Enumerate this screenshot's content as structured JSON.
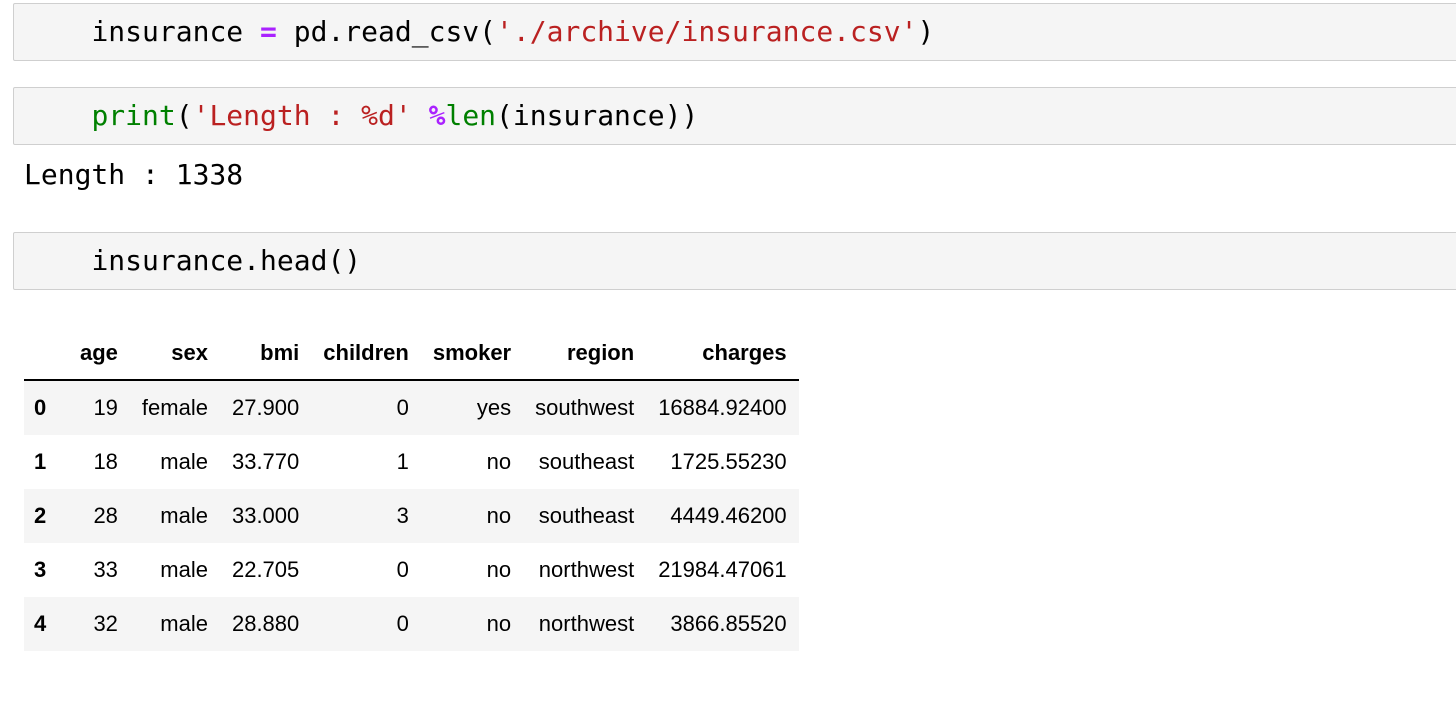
{
  "cells": [
    {
      "tokens": [
        {
          "text": "insurance ",
          "kind": "plain"
        },
        {
          "text": "=",
          "kind": "op"
        },
        {
          "text": " pd.read_csv(",
          "kind": "plain"
        },
        {
          "text": "'./archive/insurance.csv'",
          "kind": "str"
        },
        {
          "text": ")",
          "kind": "plain"
        }
      ]
    },
    {
      "tokens": [
        {
          "text": "print",
          "kind": "builtin"
        },
        {
          "text": "(",
          "kind": "plain"
        },
        {
          "text": "'Length : %d'",
          "kind": "str"
        },
        {
          "text": " ",
          "kind": "plain"
        },
        {
          "text": "%",
          "kind": "op"
        },
        {
          "text": "len",
          "kind": "builtin"
        },
        {
          "text": "(insurance))",
          "kind": "plain"
        }
      ],
      "output": "Length : 1338"
    },
    {
      "tokens": [
        {
          "text": "insurance.head()",
          "kind": "plain"
        }
      ]
    }
  ],
  "dataframe": {
    "columns": [
      "age",
      "sex",
      "bmi",
      "children",
      "smoker",
      "region",
      "charges"
    ],
    "rows": [
      {
        "index": "0",
        "values": [
          "19",
          "female",
          "27.900",
          "0",
          "yes",
          "southwest",
          "16884.92400"
        ]
      },
      {
        "index": "1",
        "values": [
          "18",
          "male",
          "33.770",
          "1",
          "no",
          "southeast",
          "1725.55230"
        ]
      },
      {
        "index": "2",
        "values": [
          "28",
          "male",
          "33.000",
          "3",
          "no",
          "southeast",
          "4449.46200"
        ]
      },
      {
        "index": "3",
        "values": [
          "33",
          "male",
          "22.705",
          "0",
          "no",
          "northwest",
          "21984.47061"
        ]
      },
      {
        "index": "4",
        "values": [
          "32",
          "male",
          "28.880",
          "0",
          "no",
          "northwest",
          "3866.85520"
        ]
      }
    ]
  },
  "colors": {
    "string": "#ba2121",
    "operator": "#aa22ff",
    "builtin": "#008000",
    "cell_background": "#f5f5f5",
    "cell_border": "#cfcfcf"
  }
}
